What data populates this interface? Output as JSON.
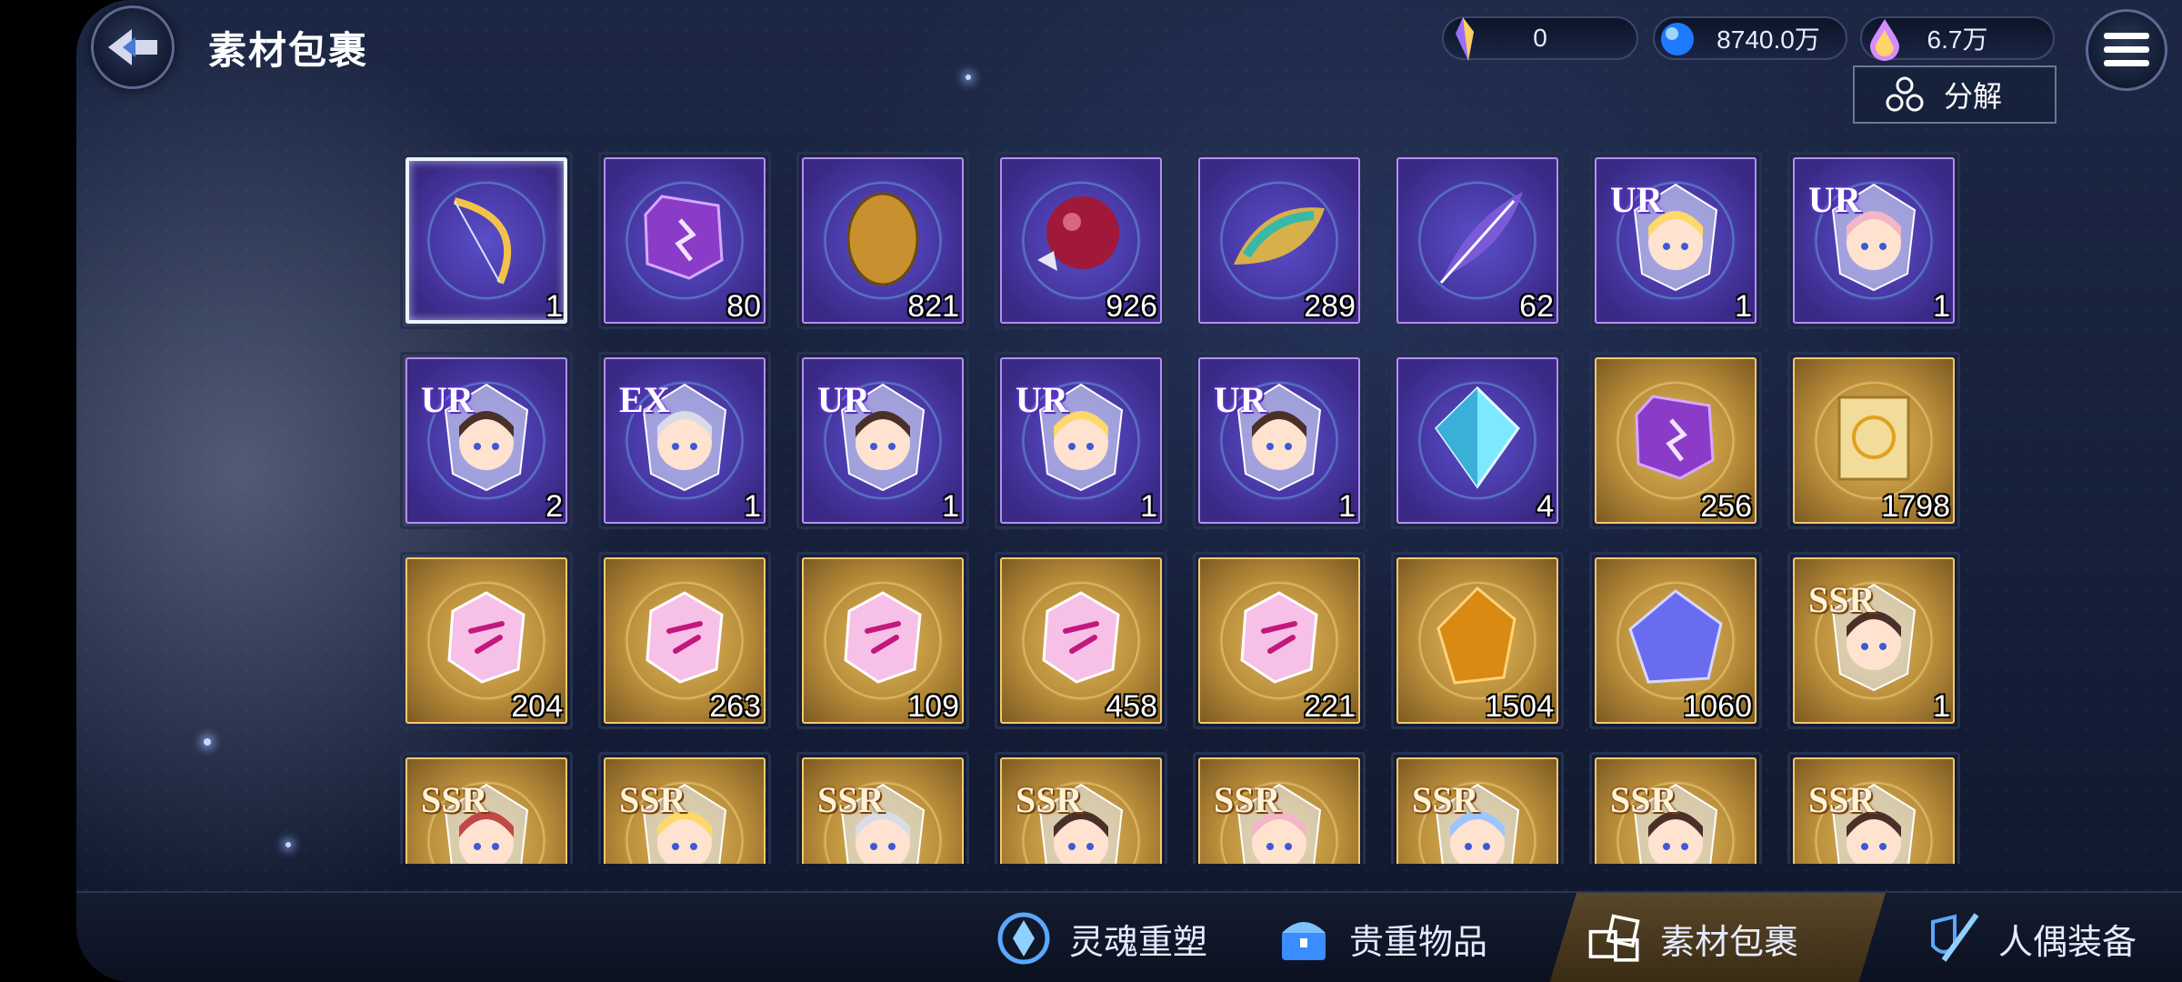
{
  "header": {
    "title": "素材包裹",
    "decompose_label": "分解"
  },
  "currencies": [
    {
      "name": "crystal-shard",
      "value": "0"
    },
    {
      "name": "blue-orb",
      "value": "8740.0万"
    },
    {
      "name": "rainbow-drop",
      "value": "6.7万"
    }
  ],
  "items": [
    {
      "icon": "golden-bow-icon",
      "rarity": "purple",
      "badge": "",
      "count": "1",
      "selected": true
    },
    {
      "icon": "purple-rune-stone-icon",
      "rarity": "purple",
      "badge": "",
      "count": "80"
    },
    {
      "icon": "golden-egg-icon",
      "rarity": "purple",
      "badge": "",
      "count": "821"
    },
    {
      "icon": "red-crystal-cluster-icon",
      "rarity": "purple",
      "badge": "",
      "count": "926"
    },
    {
      "icon": "jeweled-leaf-icon",
      "rarity": "purple",
      "badge": "",
      "count": "289"
    },
    {
      "icon": "feather-quill-icon",
      "rarity": "purple",
      "badge": "",
      "count": "62"
    },
    {
      "icon": "doll-crystal-blonde-icon",
      "rarity": "purple",
      "badge": "UR",
      "count": "1"
    },
    {
      "icon": "doll-crystal-pink-icon",
      "rarity": "purple",
      "badge": "UR",
      "count": "1"
    },
    {
      "icon": "doll-crystal-brown-icon",
      "rarity": "purple",
      "badge": "UR",
      "count": "2"
    },
    {
      "icon": "doll-crystal-silver-icon",
      "rarity": "purple",
      "badge": "EX",
      "count": "1"
    },
    {
      "icon": "doll-crystal-headphone-icon",
      "rarity": "purple",
      "badge": "UR",
      "count": "1"
    },
    {
      "icon": "doll-crystal-gold-icon",
      "rarity": "purple",
      "badge": "UR",
      "count": "1"
    },
    {
      "icon": "doll-crystal-black-icon",
      "rarity": "purple",
      "badge": "UR",
      "count": "1"
    },
    {
      "icon": "blue-diamond-icon",
      "rarity": "purple",
      "badge": "",
      "count": "4"
    },
    {
      "icon": "purple-rune-stone-icon",
      "rarity": "gold",
      "badge": "",
      "count": "256"
    },
    {
      "icon": "golden-scroll-icon",
      "rarity": "gold",
      "badge": "",
      "count": "1798"
    },
    {
      "icon": "pink-rune-wing-icon",
      "rarity": "gold",
      "badge": "",
      "count": "204"
    },
    {
      "icon": "pink-rune-flag-icon",
      "rarity": "gold",
      "badge": "",
      "count": "263"
    },
    {
      "icon": "pink-rune-swirl-icon",
      "rarity": "gold",
      "badge": "",
      "count": "109"
    },
    {
      "icon": "pink-rune-flower-icon",
      "rarity": "gold",
      "badge": "",
      "count": "458"
    },
    {
      "icon": "pink-rune-knot-icon",
      "rarity": "gold",
      "badge": "",
      "count": "221"
    },
    {
      "icon": "amber-gem-icon",
      "rarity": "gold",
      "badge": "",
      "count": "1504"
    },
    {
      "icon": "violet-crystal-icon",
      "rarity": "gold",
      "badge": "",
      "count": "1060"
    },
    {
      "icon": "doll-crystal-dark-icon",
      "rarity": "gold",
      "badge": "SSR",
      "count": "1"
    },
    {
      "icon": "doll-crystal-red-icon",
      "rarity": "gold",
      "badge": "SSR",
      "count": ""
    },
    {
      "icon": "doll-crystal-blonde-icon",
      "rarity": "gold",
      "badge": "SSR",
      "count": ""
    },
    {
      "icon": "doll-crystal-white-icon",
      "rarity": "gold",
      "badge": "SSR",
      "count": ""
    },
    {
      "icon": "doll-crystal-black-icon",
      "rarity": "gold",
      "badge": "SSR",
      "count": ""
    },
    {
      "icon": "doll-crystal-pink-icon",
      "rarity": "gold",
      "badge": "SSR",
      "count": ""
    },
    {
      "icon": "doll-crystal-blue-icon",
      "rarity": "gold",
      "badge": "SSR",
      "count": ""
    },
    {
      "icon": "doll-crystal-dark-icon",
      "rarity": "gold",
      "badge": "SSR",
      "count": ""
    },
    {
      "icon": "doll-crystal-twin-icon",
      "rarity": "gold",
      "badge": "SSR",
      "count": ""
    }
  ],
  "tabs": [
    {
      "label": "灵魂重塑",
      "icon": "soul-reshape-icon",
      "active": false
    },
    {
      "label": "贵重物品",
      "icon": "treasure-chest-icon",
      "active": false
    },
    {
      "label": "素材包裹",
      "icon": "material-boxes-icon",
      "active": true
    },
    {
      "label": "人偶装备",
      "icon": "sword-shield-icon",
      "active": false
    }
  ],
  "colors": {
    "purple_frame": "#b58ef2",
    "gold_frame": "#f2c96e",
    "background": "#1c2744"
  }
}
